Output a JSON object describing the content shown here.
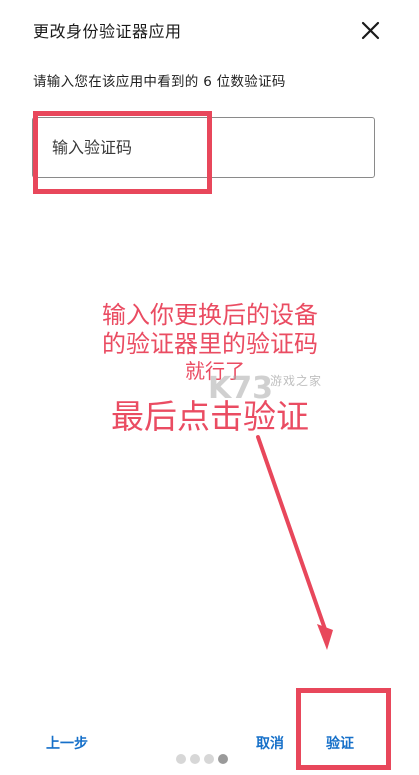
{
  "dialog": {
    "title": "更改身份验证器应用",
    "instruction": "请输入您在该应用中看到的 6 位数验证码",
    "code_input": {
      "placeholder": "输入验证码",
      "value": ""
    }
  },
  "annotation": {
    "line1": "输入你更换后的设备",
    "line2": "的验证器里的验证码",
    "line3": "就行了",
    "line4": "最后点击验证",
    "color": "#ea4c62"
  },
  "watermark": {
    "text": "游戏之家"
  },
  "footer": {
    "back_label": "上一步",
    "cancel_label": "取消",
    "verify_label": "验证",
    "pager_count": 4,
    "pager_active": 3
  },
  "colors": {
    "accent": "#1670c9",
    "highlight": "#e8475b"
  },
  "icons": {
    "close": "close-icon"
  }
}
